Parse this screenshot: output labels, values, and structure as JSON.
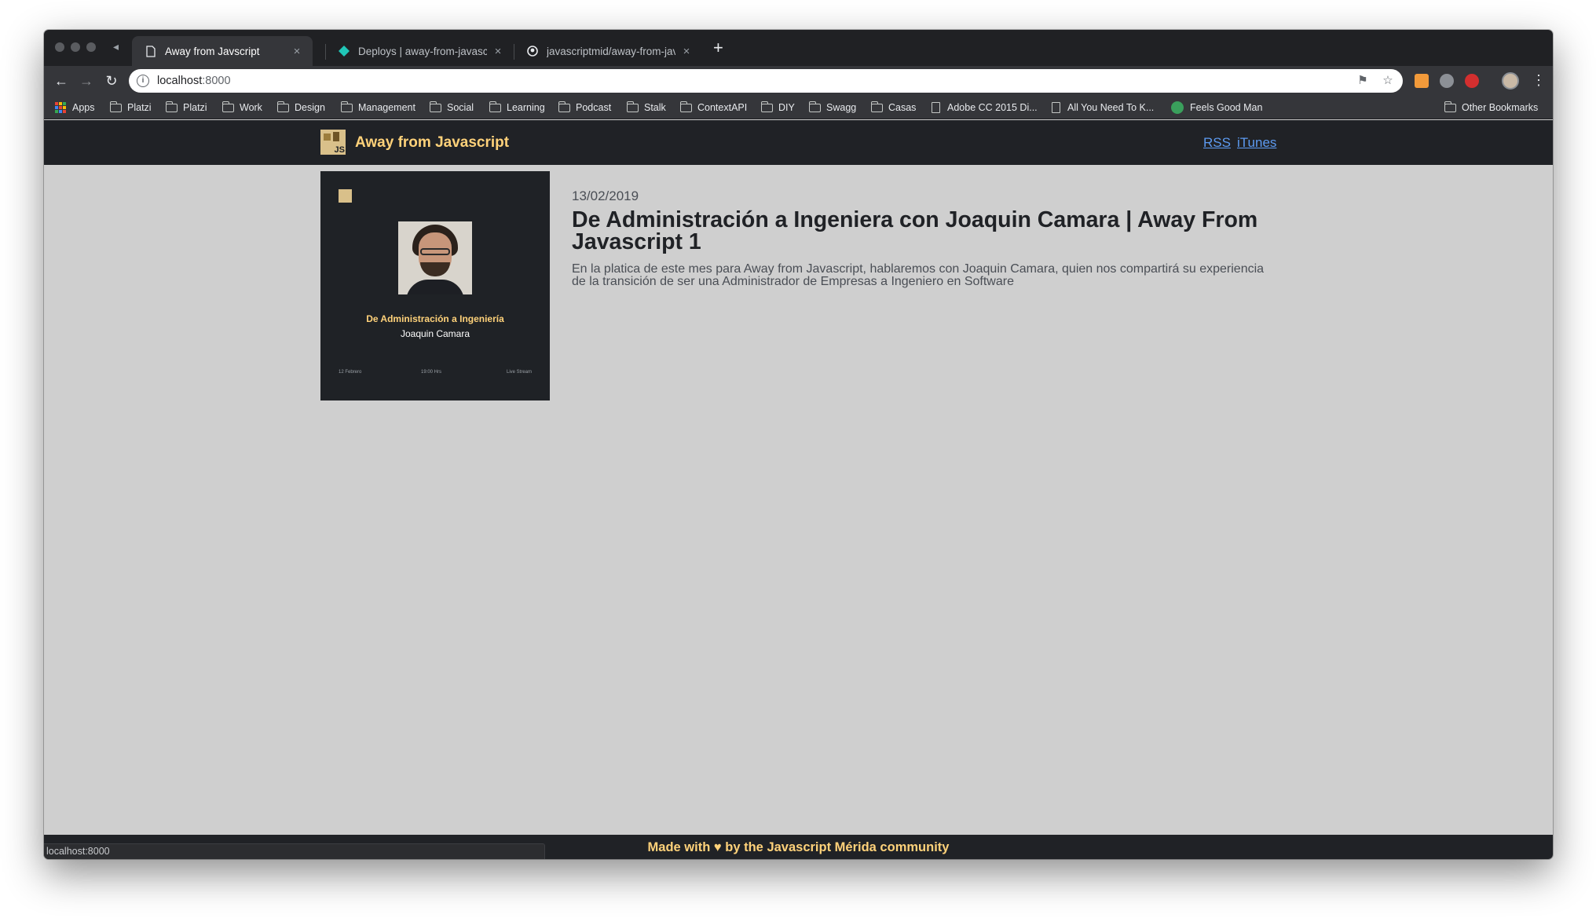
{
  "browser": {
    "tabs": [
      {
        "title": "Away from Javscript",
        "favicon": "page-icon",
        "active": true
      },
      {
        "title": "Deploys | away-from-javascript",
        "favicon": "netlify-icon",
        "active": false
      },
      {
        "title": "javascriptmid/away-from-javascript",
        "favicon": "github-icon",
        "active": false
      }
    ],
    "close_glyph": "×",
    "new_tab_glyph": "+",
    "url_host": "localhost",
    "url_port": ":8000",
    "bookmarks": [
      {
        "label": "Apps",
        "icon": "apps-grid-icon"
      },
      {
        "label": "Platzi",
        "icon": "folder-icon"
      },
      {
        "label": "Platzi",
        "icon": "folder-icon"
      },
      {
        "label": "Work",
        "icon": "folder-icon"
      },
      {
        "label": "Design",
        "icon": "folder-icon"
      },
      {
        "label": "Management",
        "icon": "folder-icon"
      },
      {
        "label": "Social",
        "icon": "folder-icon"
      },
      {
        "label": "Learning",
        "icon": "folder-icon"
      },
      {
        "label": "Podcast",
        "icon": "folder-icon"
      },
      {
        "label": "Stalk",
        "icon": "folder-icon"
      },
      {
        "label": "ContextAPI",
        "icon": "folder-icon"
      },
      {
        "label": "DIY",
        "icon": "folder-icon"
      },
      {
        "label": "Swagg",
        "icon": "folder-icon"
      },
      {
        "label": "Casas",
        "icon": "folder-icon"
      },
      {
        "label": "Adobe CC 2015 Di...",
        "icon": "page-icon"
      },
      {
        "label": "All You Need To K...",
        "icon": "page-icon"
      },
      {
        "label": "Feels Good Man",
        "icon": "pepe-icon"
      },
      {
        "label": "Other Bookmarks",
        "icon": "folder-icon"
      }
    ],
    "status_url": "localhost:8000"
  },
  "site": {
    "title": "Away from Javascript",
    "nav": {
      "rss": "RSS",
      "itunes": "iTunes"
    }
  },
  "episode": {
    "date": "13/02/2019",
    "title": "De Administración a Ingeniera con Joaquin Camara | Away From Javascript 1",
    "description": "En la platica de este mes para Away from Javascript, hablaremos con Joaquin Camara, quien nos compartirá su experiencia de la transición de ser una Administrador de Empresas a Ingeniero en Software",
    "cover": {
      "headline": "De Administración a Ingeniería",
      "guest": "Joaquin Camara",
      "date_text": "12 Febrero",
      "time_text": "19:00 Hrs",
      "mode_text": "Live Stream"
    }
  },
  "footer": {
    "before": "Made with ",
    "heart": "♥",
    "after": " by the Javascript Mérida community"
  },
  "colors": {
    "accent": "#ffd27a",
    "link": "#5d9bf2",
    "header_bg": "#202226",
    "page_bg": "#cfcfcf"
  }
}
